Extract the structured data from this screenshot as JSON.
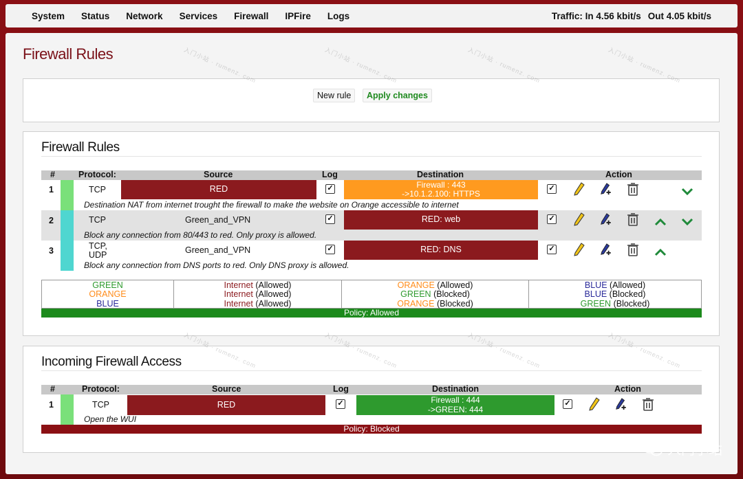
{
  "nav": {
    "items": [
      "System",
      "Status",
      "Network",
      "Services",
      "Firewall",
      "IPFire",
      "Logs"
    ],
    "traffic_in": "Traffic: In 4.56 kbit/s",
    "traffic_out": "Out 4.05 kbit/s"
  },
  "page_title": "Firewall Rules",
  "actions": {
    "new_rule": "New rule",
    "apply_changes": "Apply changes"
  },
  "rules_section": {
    "title": "Firewall Rules",
    "headers": {
      "num": "#",
      "protocol": "Protocol:",
      "source": "Source",
      "log": "Log",
      "destination": "Destination",
      "action": "Action"
    },
    "rules": [
      {
        "num": "1",
        "protocol": "TCP",
        "source": "RED",
        "dest_line1": "Firewall : 443",
        "dest_line2": "->10.1.2.100: HTTPS",
        "description": "Destination NAT from internet trought the firewall to make the website on Orange accessible to internet"
      },
      {
        "num": "2",
        "protocol": "TCP",
        "source": "Green_and_VPN",
        "dest_line1": "RED: web",
        "description": "Block any connection from 80/443 to red. Only proxy is allowed."
      },
      {
        "num": "3",
        "protocol": "TCP,",
        "protocol2": "UDP",
        "source": "Green_and_VPN",
        "dest_line1": "RED: DNS",
        "description": "Block any connection from DNS ports to red. Only DNS proxy is allowed."
      }
    ],
    "policy_table": {
      "col1": [
        "GREEN",
        "ORANGE",
        "BLUE"
      ],
      "col2": [
        [
          "Internet",
          "(Allowed)"
        ],
        [
          "Internet",
          "(Allowed)"
        ],
        [
          "Internet",
          "(Allowed)"
        ]
      ],
      "col3": [
        [
          "ORANGE",
          "(Allowed)"
        ],
        [
          "GREEN",
          "(Blocked)"
        ],
        [
          "ORANGE",
          "(Blocked)"
        ]
      ],
      "col4": [
        [
          "BLUE",
          "(Allowed)"
        ],
        [
          "BLUE",
          "(Blocked)"
        ],
        [
          "GREEN",
          "(Blocked)"
        ]
      ]
    },
    "policy": "Policy: Allowed"
  },
  "incoming_section": {
    "title": "Incoming Firewall Access",
    "headers": {
      "num": "#",
      "protocol": "Protocol:",
      "source": "Source",
      "log": "Log",
      "destination": "Destination",
      "action": "Action"
    },
    "rule": {
      "num": "1",
      "protocol": "TCP",
      "source": "RED",
      "dest_line1": "Firewall : 444",
      "dest_line2": "->GREEN: 444",
      "description": "Open the WUI"
    },
    "policy": "Policy: Blocked"
  },
  "watermark": {
    "text": "入门小站 · rumenz. com",
    "logo": "入门小站"
  },
  "colors": {
    "red": "#8b1a1e",
    "orange": "#ff9a1f",
    "green": "#2e9a2e",
    "zone_green": "#7ae07a",
    "zone_cyan": "#4fd6d0"
  }
}
